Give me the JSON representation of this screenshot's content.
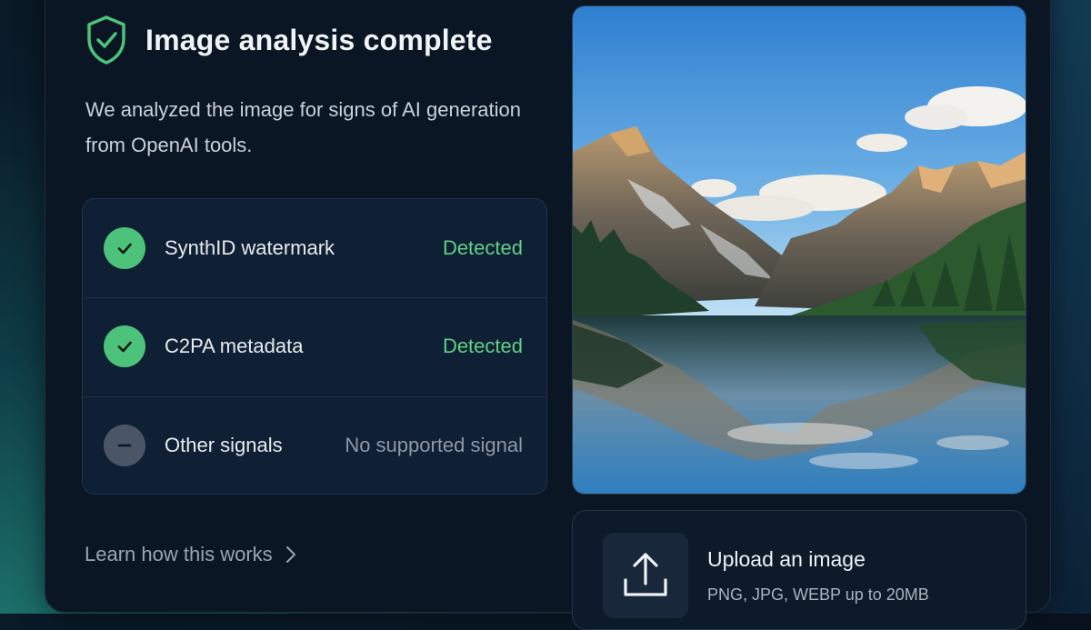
{
  "header": {
    "title": "Image analysis complete",
    "description": "We analyzed the image for signs of AI generation from OpenAI tools.",
    "icon": "shield-check-icon"
  },
  "signals": [
    {
      "label": "SynthID watermark",
      "status": "Detected",
      "state": "detected",
      "icon": "check-icon"
    },
    {
      "label": "C2PA metadata",
      "status": "Detected",
      "state": "detected",
      "icon": "check-icon"
    },
    {
      "label": "Other signals",
      "status": "No supported signal",
      "state": "none",
      "icon": "minus-icon"
    }
  ],
  "learn_more": {
    "label": "Learn how this works",
    "icon": "chevron-right-icon"
  },
  "preview": {
    "subject": "mountain lake landscape"
  },
  "upload": {
    "title": "Upload an image",
    "subtitle": "PNG, JPG, WEBP up to 20MB",
    "icon": "upload-icon"
  },
  "colors": {
    "accent_green": "#4cc27a",
    "status_green": "#5fd087",
    "card_bg": "#0b1624"
  }
}
